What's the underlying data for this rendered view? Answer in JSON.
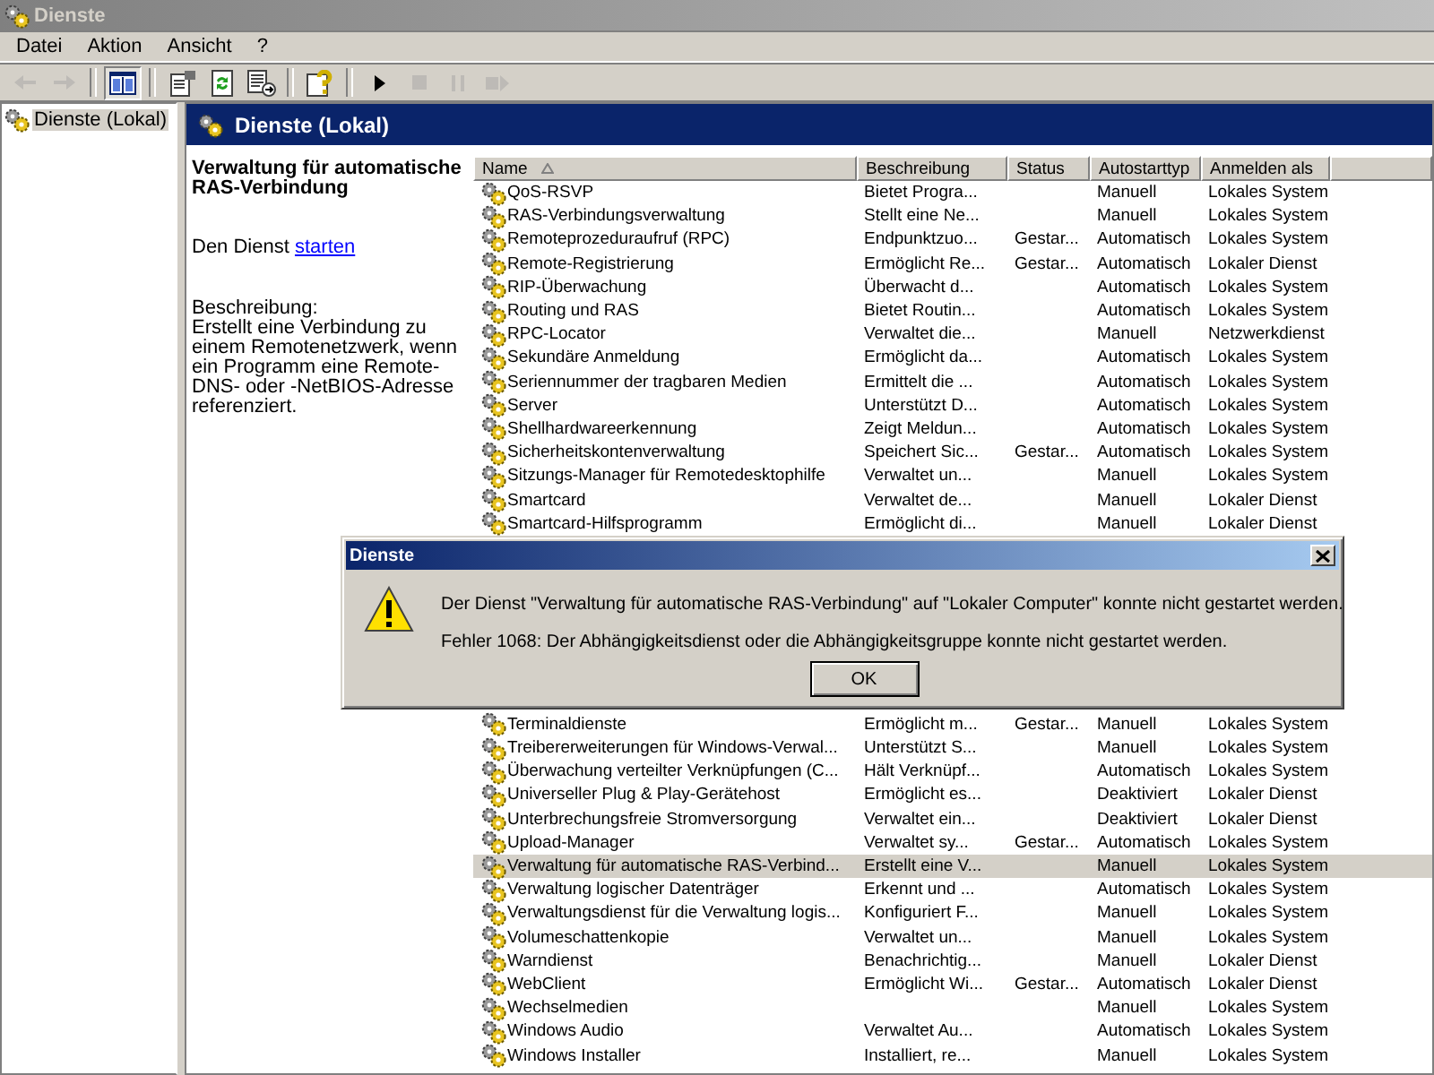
{
  "window": {
    "title": "Dienste",
    "active": false
  },
  "menu": [
    "Datei",
    "Aktion",
    "Ansicht",
    "?"
  ],
  "toolbar": [
    {
      "kind": "back",
      "disabled": true,
      "pressed": false
    },
    {
      "kind": "forward",
      "disabled": true,
      "pressed": false
    },
    {
      "kind": "separator"
    },
    {
      "kind": "tree",
      "disabled": false,
      "pressed": true
    },
    {
      "kind": "separator"
    },
    {
      "kind": "properties",
      "disabled": false,
      "pressed": false
    },
    {
      "kind": "refresh",
      "disabled": false,
      "pressed": false
    },
    {
      "kind": "export",
      "disabled": false,
      "pressed": false
    },
    {
      "kind": "separator"
    },
    {
      "kind": "help",
      "disabled": false,
      "pressed": false
    },
    {
      "kind": "separator"
    },
    {
      "kind": "play",
      "disabled": false,
      "pressed": false
    },
    {
      "kind": "stop",
      "disabled": true,
      "pressed": false
    },
    {
      "kind": "pause",
      "disabled": true,
      "pressed": false
    },
    {
      "kind": "restart",
      "disabled": true,
      "pressed": false
    }
  ],
  "tree": {
    "items": [
      {
        "label": "Dienste (Lokal)",
        "selected": true
      }
    ]
  },
  "pane_header": {
    "title": "Dienste (Lokal)"
  },
  "details": {
    "title": "Verwaltung für automatische RAS-Verbindung",
    "action": {
      "text": "Den Dienst",
      "link": "starten"
    },
    "description_label": "Beschreibung:",
    "description": "Erstellt eine Verbindung zu einem Remotenetzwerk, wenn ein Programm eine Remote-DNS- oder -NetBIOS-Adresse referenziert."
  },
  "table": {
    "columns": [
      {
        "label": "Name",
        "sorted": true
      },
      {
        "label": "Beschreibung",
        "sorted": false
      },
      {
        "label": "Status",
        "sorted": false
      },
      {
        "label": "Autostarttyp",
        "sorted": false
      },
      {
        "label": "Anmelden als",
        "sorted": false
      }
    ],
    "rows_above_dialog": [
      {
        "name": "QoS-RSVP",
        "description": "Bietet Progra...",
        "startup": "Manuell",
        "logon": "Lokales System",
        "selected": false
      },
      {
        "name": "RAS-Verbindungsverwaltung",
        "description": "Stellt eine Ne...",
        "startup": "Manuell",
        "logon": "Lokales System",
        "selected": false
      },
      {
        "name": "Remoteprozeduraufruf (RPC)",
        "description": "Endpunktzuo...",
        "status": "Gestar...",
        "startup": "Automatisch",
        "logon": "Lokales System",
        "selected": false
      },
      {
        "name": "Remote-Registrierung",
        "description": "Ermöglicht Re...",
        "status": "Gestar...",
        "startup": "Automatisch",
        "logon": "Lokaler Dienst",
        "selected": false
      },
      {
        "name": "RIP-Überwachung",
        "description": "Überwacht d...",
        "startup": "Automatisch",
        "logon": "Lokales System",
        "selected": false
      },
      {
        "name": "Routing und RAS",
        "description": "Bietet Routin...",
        "startup": "Automatisch",
        "logon": "Lokales System",
        "selected": false
      },
      {
        "name": "RPC-Locator",
        "description": "Verwaltet die...",
        "startup": "Manuell",
        "logon": "Netzwerkdienst",
        "selected": false
      },
      {
        "name": "Sekundäre Anmeldung",
        "description": "Ermöglicht da...",
        "startup": "Automatisch",
        "logon": "Lokales System",
        "selected": false
      },
      {
        "name": "Seriennummer der tragbaren Medien",
        "description": "Ermittelt die ...",
        "startup": "Automatisch",
        "logon": "Lokales System",
        "selected": false
      },
      {
        "name": "Server",
        "description": "Unterstützt D...",
        "startup": "Automatisch",
        "logon": "Lokales System",
        "selected": false
      },
      {
        "name": "Shellhardwareerkennung",
        "description": "Zeigt Meldun...",
        "startup": "Automatisch",
        "logon": "Lokales System",
        "selected": false
      },
      {
        "name": "Sicherheitskontenverwaltung",
        "description": "Speichert Sic...",
        "status": "Gestar...",
        "startup": "Automatisch",
        "logon": "Lokales System",
        "selected": false
      },
      {
        "name": "Sitzungs-Manager für Remotedesktophilfe",
        "description": "Verwaltet un...",
        "startup": "Manuell",
        "logon": "Lokales System",
        "selected": false
      },
      {
        "name": "Smartcard",
        "description": "Verwaltet de...",
        "startup": "Manuell",
        "logon": "Lokaler Dienst",
        "selected": false
      },
      {
        "name": "Smartcard-Hilfsprogramm",
        "description": "Ermöglicht di...",
        "startup": "Manuell",
        "logon": "Lokaler Dienst",
        "selected": false
      }
    ],
    "rows_below_dialog": [
      {
        "name": "Terminaldienste",
        "description": "Ermöglicht m...",
        "status": "Gestar...",
        "startup": "Manuell",
        "logon": "Lokales System",
        "selected": false
      },
      {
        "name": "Treibererweiterungen für Windows-Verwal...",
        "description": "Unterstützt S...",
        "startup": "Manuell",
        "logon": "Lokales System",
        "selected": false
      },
      {
        "name": "Überwachung verteilter Verknüpfungen (C...",
        "description": "Hält Verknüpf...",
        "startup": "Automatisch",
        "logon": "Lokales System",
        "selected": false
      },
      {
        "name": "Universeller Plug & Play-Gerätehost",
        "description": "Ermöglicht es...",
        "startup": "Deaktiviert",
        "logon": "Lokaler Dienst",
        "selected": false
      },
      {
        "name": "Unterbrechungsfreie Stromversorgung",
        "description": "Verwaltet ein...",
        "startup": "Deaktiviert",
        "logon": "Lokaler Dienst",
        "selected": false
      },
      {
        "name": "Upload-Manager",
        "description": "Verwaltet sy...",
        "status": "Gestar...",
        "startup": "Automatisch",
        "logon": "Lokales System",
        "selected": false
      },
      {
        "name": "Verwaltung für automatische RAS-Verbind...",
        "description": "Erstellt eine V...",
        "startup": "Manuell",
        "logon": "Lokales System",
        "selected": true
      },
      {
        "name": "Verwaltung logischer Datenträger",
        "description": "Erkennt und ...",
        "startup": "Automatisch",
        "logon": "Lokales System",
        "selected": false
      },
      {
        "name": "Verwaltungsdienst für die Verwaltung logis...",
        "description": "Konfiguriert F...",
        "startup": "Manuell",
        "logon": "Lokales System",
        "selected": false
      },
      {
        "name": "Volumeschattenkopie",
        "description": "Verwaltet un...",
        "startup": "Manuell",
        "logon": "Lokales System",
        "selected": false
      },
      {
        "name": "Warndienst",
        "description": "Benachrichtig...",
        "startup": "Manuell",
        "logon": "Lokaler Dienst",
        "selected": false
      },
      {
        "name": "WebClient",
        "description": "Ermöglicht Wi...",
        "status": "Gestar...",
        "startup": "Automatisch",
        "logon": "Lokaler Dienst",
        "selected": false
      },
      {
        "name": "Wechselmedien",
        "startup": "Manuell",
        "logon": "Lokales System",
        "selected": false
      },
      {
        "name": "Windows Audio",
        "description": "Verwaltet Au...",
        "startup": "Automatisch",
        "logon": "Lokales System",
        "selected": false
      },
      {
        "name": "Windows Installer",
        "description": "Installiert, re...",
        "startup": "Manuell",
        "logon": "Lokales System",
        "selected": false
      }
    ]
  },
  "dialog": {
    "title": "Dienste",
    "kind": "warning",
    "messages": [
      "Der Dienst \"Verwaltung für automatische RAS-Verbindung\" auf \"Lokaler Computer\" konnte nicht gestartet werden.",
      "Fehler 1068: Der Abhängigkeitsdienst oder die Abhängigkeitsgruppe konnte nicht gestartet werden."
    ],
    "button": "OK"
  }
}
